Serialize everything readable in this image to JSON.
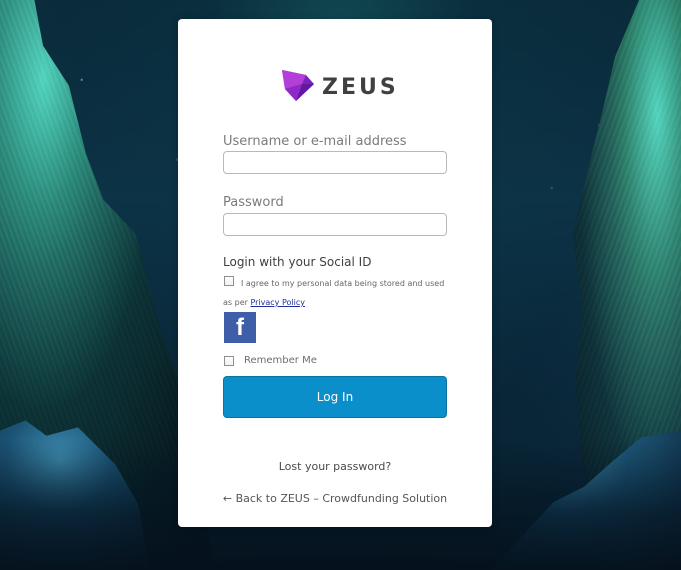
{
  "login": {
    "brand_name": "ZEUS",
    "username_label": "Username or e-mail address",
    "password_label": "Password",
    "social_login_title": "Login with your Social ID",
    "privacy_text_before": "I agree to my personal data being stored and used as per",
    "privacy_link_text": "Privacy Policy",
    "facebook_icon_text": "f",
    "remember_me_label": "Remember Me",
    "login_button_label": "Log In",
    "lost_password_text": "Lost your password?",
    "back_link_text": "← Back to ZEUS – Crowdfunding Solution"
  },
  "inputs": {
    "username_value": "",
    "password_value": ""
  },
  "colors": {
    "brand_purple": "#7d22b9",
    "brand_violet": "#b43ed8",
    "login_blue": "#0b8fca",
    "facebook_blue": "#3e5ea8",
    "link_blue": "#1f2f9b"
  },
  "icons": {
    "logo": "zeus-logo-icon",
    "facebook": "facebook-icon"
  }
}
